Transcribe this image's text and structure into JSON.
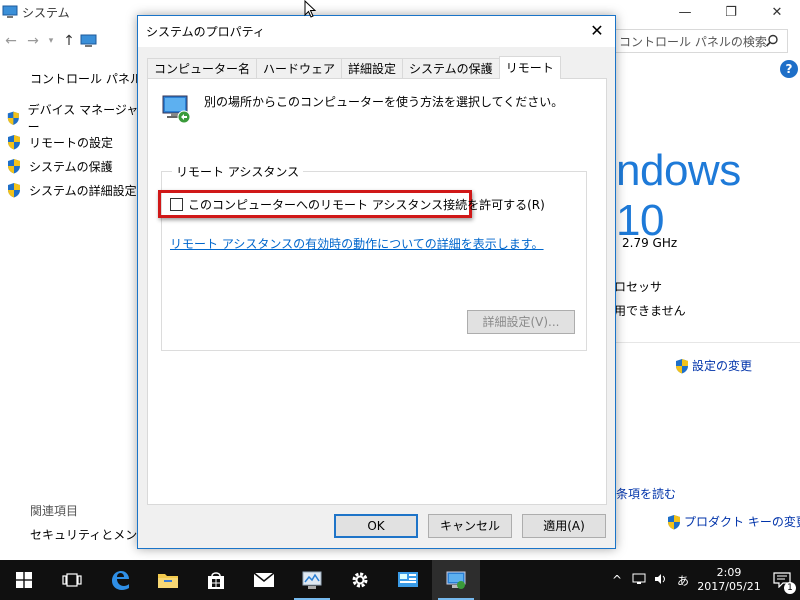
{
  "background_window": {
    "title": "システム",
    "search_placeholder": "コントロール パネルの検索",
    "help": "?",
    "left_pane": {
      "home": "コントロール パネル ホーム",
      "links": [
        "デバイス マネージャー",
        "リモートの設定",
        "システムの保護",
        "システムの詳細設定"
      ],
      "related_heading": "関連項目",
      "security": "セキュリティとメンテナンス"
    },
    "right_pane": {
      "edition": "ndows 10",
      "cpu_speed": "2.79 GHz",
      "processor": "ロセッサ",
      "pen_touch": "用できません",
      "change_settings": "設定の変更",
      "license": "条項を読む",
      "change_product_key": "プロダクト キーの変更"
    }
  },
  "dialog": {
    "title": "システムのプロパティ",
    "close": "✕",
    "tabs": [
      "コンピューター名",
      "ハードウェア",
      "詳細設定",
      "システムの保護",
      "リモート"
    ],
    "active_tab": "リモート",
    "intro": "別の場所からこのコンピューターを使う方法を選択してください。",
    "group_label": "リモート アシスタンス",
    "checkbox_label": "このコンピューターへのリモート アシスタンス接続を許可する(R)",
    "checkbox_checked": false,
    "detail_link": "リモート アシスタンスの有効時の動作についての詳細を表示します。",
    "advanced_button": "詳細設定(V)...",
    "ok": "OK",
    "cancel": "キャンセル",
    "apply": "適用(A)"
  },
  "taskbar": {
    "time": "2:09",
    "date": "2017/05/21",
    "ime": "あ",
    "notification_count": "1"
  },
  "colors": {
    "accent": "#1e74c8",
    "highlight": "#d01818",
    "link": "#0066cc",
    "win10_blue": "#1e7ad8",
    "taskbar": "#101010"
  }
}
